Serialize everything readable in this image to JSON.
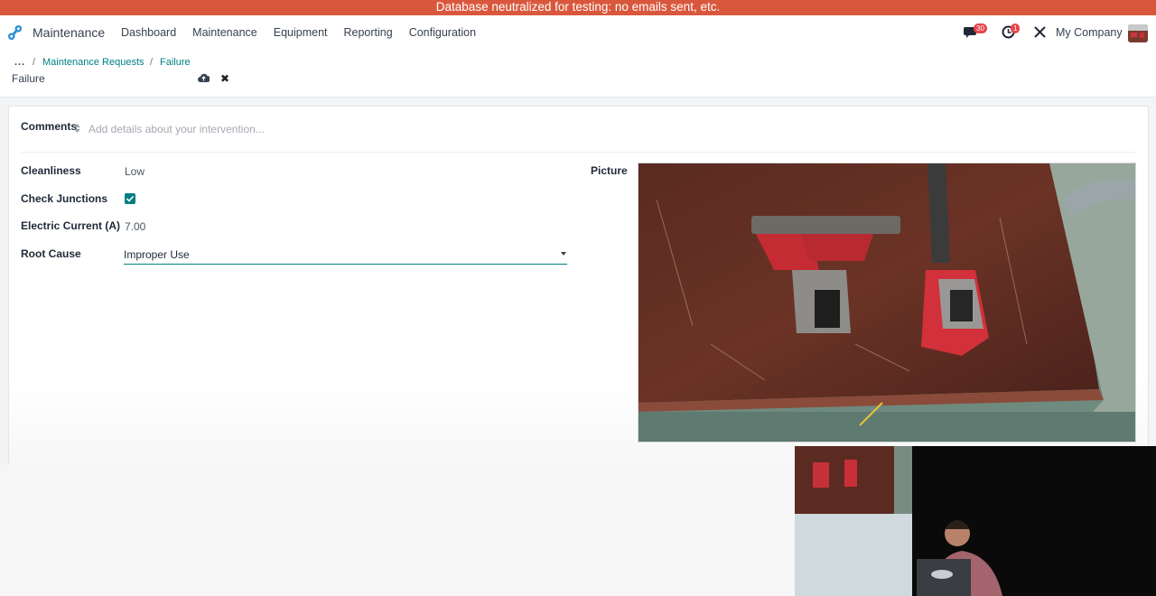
{
  "banner": {
    "text": "Database neutralized for testing: no emails sent, etc."
  },
  "navbar": {
    "app_name": "Maintenance",
    "menu": [
      "Dashboard",
      "Maintenance",
      "Equipment",
      "Reporting",
      "Configuration"
    ],
    "messages_count": "30",
    "activities_count": "1",
    "company": "My Company"
  },
  "breadcrumb": {
    "dots": "...",
    "items": [
      "Maintenance Requests",
      "Failure"
    ],
    "separator": "/"
  },
  "record": {
    "title": "Failure"
  },
  "form": {
    "comments_label": "Comments",
    "comments_placeholder": "Add details about your intervention...",
    "cleanliness_label": "Cleanliness",
    "cleanliness_value": "Low",
    "check_junctions_label": "Check Junctions",
    "check_junctions_checked": true,
    "electric_current_label": "Electric Current (A)",
    "electric_current_value": "7.00",
    "root_cause_label": "Root Cause",
    "root_cause_value": "Improper Use",
    "picture_label": "Picture"
  },
  "icons": {
    "app_logo": "maintenance-logo-icon",
    "messages": "chat-bubble-icon",
    "activities": "clock-icon",
    "debug": "tools-icon",
    "save": "cloud-upload-icon",
    "discard": "close-icon"
  },
  "colors": {
    "accent": "#017e84",
    "banner": "#d9583d",
    "badge": "#e8434a"
  }
}
